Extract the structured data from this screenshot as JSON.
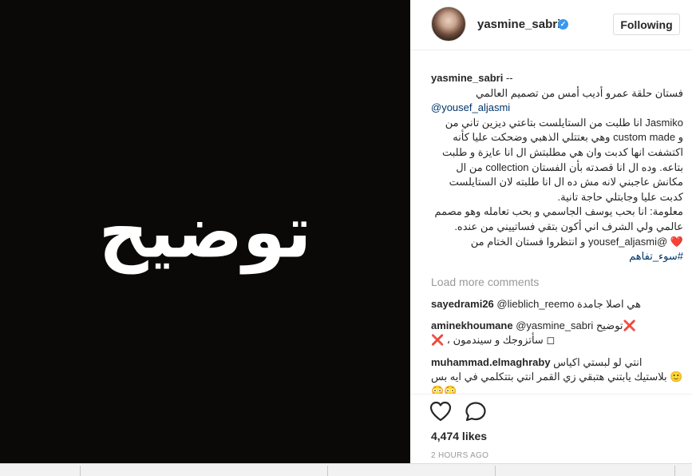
{
  "post": {
    "image_text": "توضيح"
  },
  "header": {
    "username": "yasmine_sabri",
    "verified_icon": "verified-badge-icon",
    "follow_label": "Following"
  },
  "caption": {
    "username": "yasmine_sabri",
    "lines": [
      "فستان حلقة عمرو أديب أمس من تصميم العالمي",
      "@yousef_aljasmi",
      "Jasmiko انا طلبت من الستايلست بتاعتي ديزين تاني من",
      "و custom made وهي بعتتلي الذهبي وضحكت عليا كأنه",
      "اكتشفت انها كدبت وان هي مطلبتش ال انا عايزة و طلبت",
      "بتاعه. وده ال انا قصدته بأن الفستان collection من ال",
      "مكانش عاجبني لانه مش ده ال انا طلبته لان الستايلست",
      "كدبت عليا وجابتلي حاجة تانية.",
      "معلومة: انا بحب يوسف الجاسمي و بحب تعامله وهو مصمم",
      "عالمي ولي الشرف اني أكون بتقي فساتييني من عنده.",
      "❤️ @yousef_aljasmi و انتظروا فستان الختام من",
      "#سوء_تفاهم"
    ]
  },
  "load_more": "Load more comments",
  "comments": [
    {
      "user": "sayedrami26",
      "text": "@lieblich_reemo هي اصلا جامدة"
    },
    {
      "user": "aminekhoumane",
      "text": "@yasmine_sabri توضيح❌",
      "text2": "❌ ، سأتزوجك و سيندمون ◻"
    },
    {
      "user": "muhammad.elmaghraby",
      "text": "انتي لو لبستي اكياس",
      "text2": "بلاستيك يابتني هتبقي زي القمر انتي بتتكلمي في ايه بس 🙂",
      "text3": "😳😳"
    }
  ],
  "actions": {
    "like_icon": "heart-icon",
    "comment_icon": "comment-icon",
    "likes": "4,474 likes",
    "time": "2 HOURS AGO"
  }
}
